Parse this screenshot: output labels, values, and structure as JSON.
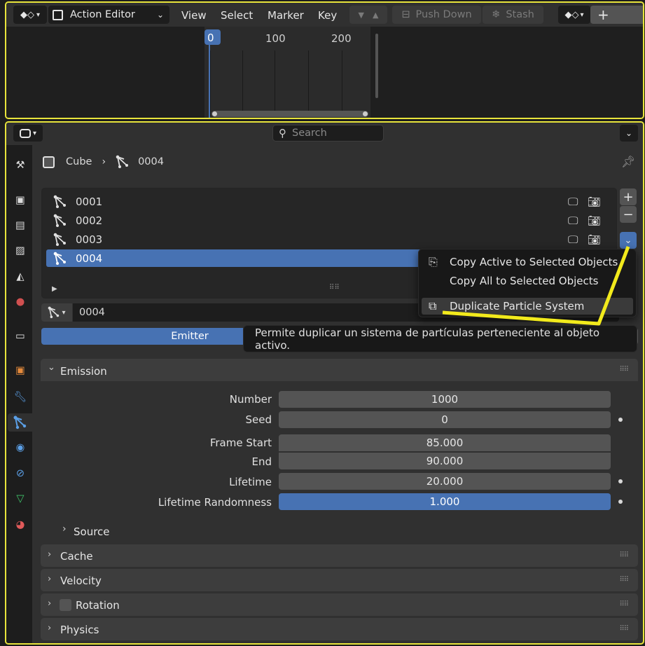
{
  "top_editor": {
    "editor_type_label": "Action Editor",
    "menus": [
      "View",
      "Select",
      "Marker",
      "Key"
    ],
    "push_down_label": "Push Down",
    "stash_label": "Stash",
    "new_label": "+",
    "frame_ticks": [
      "0",
      "100",
      "200"
    ],
    "current_frame": "0"
  },
  "properties": {
    "search_placeholder": "Search",
    "breadcrumb": {
      "object": "Cube",
      "particle_system": "0004"
    },
    "particle_list": [
      {
        "name": "0001",
        "selected": false
      },
      {
        "name": "0002",
        "selected": false
      },
      {
        "name": "0003",
        "selected": false
      },
      {
        "name": "0004",
        "selected": true
      }
    ],
    "settings_name": "0004",
    "type_tabs": {
      "emitter": "Emitter"
    },
    "emission": {
      "title": "Emission",
      "fields": {
        "number": {
          "label": "Number",
          "value": "1000"
        },
        "seed": {
          "label": "Seed",
          "value": "0"
        },
        "frame_start": {
          "label": "Frame Start",
          "value": "85.000"
        },
        "end": {
          "label": "End",
          "value": "90.000"
        },
        "lifetime": {
          "label": "Lifetime",
          "value": "20.000"
        },
        "lifetime_randomness": {
          "label": "Lifetime Randomness",
          "value": "1.000"
        }
      },
      "source_label": "Source"
    },
    "panels": {
      "cache": "Cache",
      "velocity": "Velocity",
      "rotation": "Rotation",
      "physics": "Physics"
    }
  },
  "context_menu": {
    "copy_active": "Copy Active to Selected Objects",
    "copy_all": "Copy All to Selected Objects",
    "duplicate": "Duplicate Particle System"
  },
  "tooltip": "Permite duplicar un sistema de partículas perteneciente al objeto activo.",
  "colors": {
    "accent": "#4772b3",
    "annotation": "#e8e43b"
  }
}
